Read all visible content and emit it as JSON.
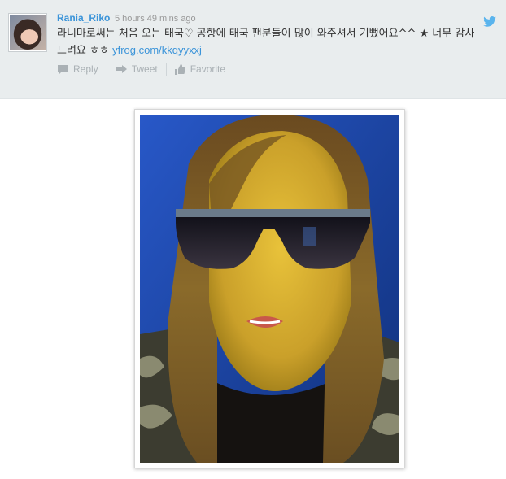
{
  "tweet": {
    "username": "Rania_Riko",
    "timestamp": "5 hours 49 mins ago",
    "text_line1": "라니마로써는 처음 오는 태국♡ 공항에 태국 팬분들이 많이 와주셔서 기뻤어요^^ ★ 너무 감사",
    "text_line2_prefix": "드려요 ㅎㅎ ",
    "link": "yfrog.com/kkqyyxxj",
    "actions": {
      "reply": "Reply",
      "tweet": "Tweet",
      "favorite": "Favorite"
    }
  },
  "icons": {
    "bird": "twitter-bird-icon",
    "reply": "reply-arrow-icon",
    "retweet": "retweet-arrow-icon",
    "favorite": "thumbs-up-icon"
  },
  "colors": {
    "link": "#3b94d9",
    "bar_bg": "#e9edee",
    "action_gray": "#aab1b5"
  }
}
